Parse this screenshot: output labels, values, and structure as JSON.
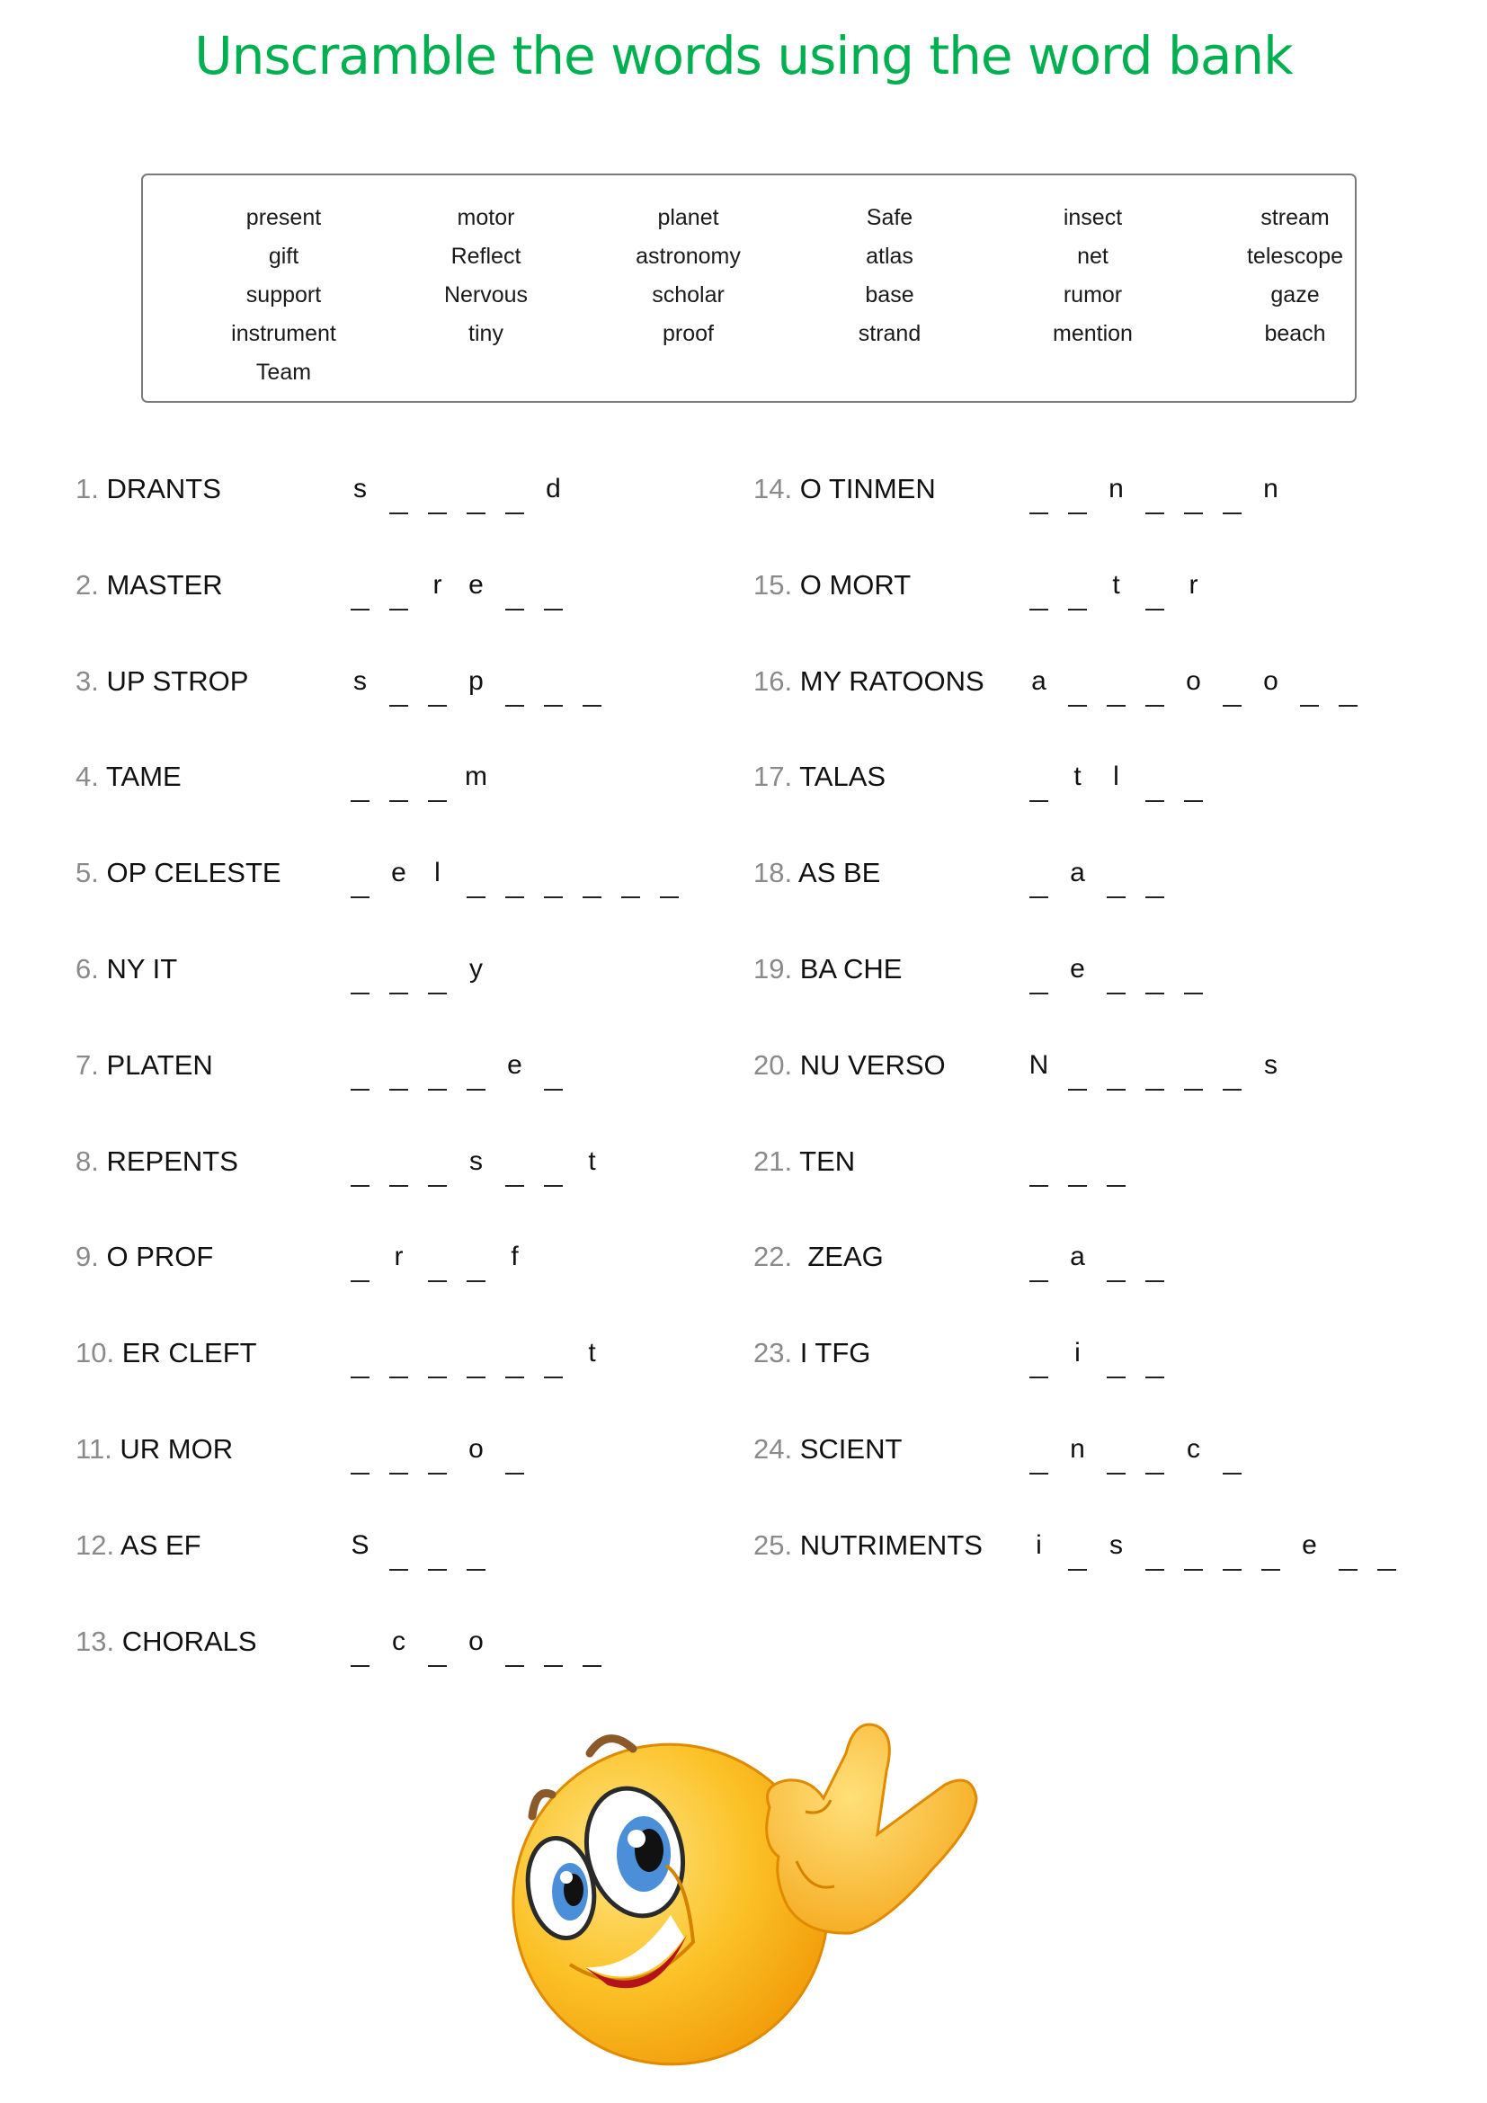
{
  "title": "Unscramble the words using  the word bank",
  "word_bank": {
    "columns": [
      [
        "present",
        "gift",
        "support",
        "instrument",
        "Team"
      ],
      [
        "motor",
        "Reflect",
        "Nervous",
        "tiny"
      ],
      [
        "planet",
        "astronomy",
        "scholar",
        "proof"
      ],
      [
        "Safe",
        "atlas",
        "base",
        "strand"
      ],
      [
        "insect",
        "net",
        "rumor",
        "mention"
      ],
      [
        "stream",
        "telescope",
        "gaze",
        "beach"
      ]
    ]
  },
  "exercises": {
    "left": [
      {
        "num": "1.",
        "word": " DRANTS",
        "pattern": [
          "s",
          "_",
          "_",
          "_",
          "_",
          "d"
        ]
      },
      {
        "num": "2.",
        "word": " MASTER",
        "pattern": [
          "_",
          "_",
          "r",
          "e",
          "_",
          "_"
        ]
      },
      {
        "num": "3.",
        "word": " UP STROP",
        "pattern": [
          "s",
          "_",
          "_",
          "p",
          "_",
          "_",
          "_"
        ]
      },
      {
        "num": "4.",
        "word": " TAME",
        "pattern": [
          "_",
          "_",
          "_",
          "m"
        ]
      },
      {
        "num": "5.",
        "word": " OP CELESTE",
        "pattern": [
          "_",
          "e",
          "l",
          "_",
          "_",
          "_",
          "_",
          "_",
          "_"
        ]
      },
      {
        "num": "6.",
        "word": " NY IT",
        "pattern": [
          "_",
          "_",
          "_",
          "y"
        ]
      },
      {
        "num": "7.",
        "word": " PLATEN",
        "pattern": [
          "_",
          "_",
          "_",
          "_",
          "e",
          "_"
        ]
      },
      {
        "num": "8.",
        "word": " REPENTS",
        "pattern": [
          "_",
          "_",
          "_",
          "s",
          "_",
          "_",
          "t"
        ]
      },
      {
        "num": "9.",
        "word": " O PROF",
        "pattern": [
          "_",
          "r",
          "_",
          "_",
          "f"
        ]
      },
      {
        "num": "10.",
        "word": " ER CLEFT",
        "pattern": [
          "_",
          "_",
          "_",
          "_",
          "_",
          "_",
          "t"
        ]
      },
      {
        "num": "11.",
        "word": " UR MOR",
        "pattern": [
          "_",
          "_",
          "_",
          "o",
          "_"
        ]
      },
      {
        "num": "12.",
        "word": " AS EF",
        "pattern": [
          "S",
          "_",
          "_",
          "_"
        ]
      },
      {
        "num": "13.",
        "word": " CHORALS",
        "pattern": [
          "_",
          "c",
          "_",
          "o",
          "_",
          "_",
          "_"
        ]
      }
    ],
    "right": [
      {
        "num": "14.",
        "word": " O TINMEN",
        "pattern": [
          "_",
          "_",
          "n",
          "_",
          "_",
          "_",
          "n"
        ]
      },
      {
        "num": "15.",
        "word": " O MORT",
        "pattern": [
          "_",
          "_",
          "t",
          "_",
          "r"
        ]
      },
      {
        "num": "16.",
        "word": " MY RATOONS",
        "pattern": [
          "a",
          "_",
          "_",
          "_",
          "o",
          "_",
          "o",
          "_",
          "_"
        ]
      },
      {
        "num": "17.",
        "word": " TALAS",
        "pattern": [
          "_",
          "t",
          "l",
          "_",
          "_"
        ]
      },
      {
        "num": "18.",
        "word": " AS BE",
        "pattern": [
          "_",
          "a",
          "_",
          "_"
        ]
      },
      {
        "num": "19.",
        "word": " BA CHE",
        "pattern": [
          "_",
          "e",
          "_",
          "_",
          "_"
        ]
      },
      {
        "num": "20.",
        "word": " NU VERSO",
        "pattern": [
          "N",
          "_",
          "_",
          "_",
          "_",
          "_",
          "s"
        ]
      },
      {
        "num": "21.",
        "word": " TEN",
        "pattern": [
          "_",
          "_",
          "_"
        ]
      },
      {
        "num": "22.",
        "word": "  ZEAG",
        "pattern": [
          "_",
          "a",
          "_",
          "_"
        ]
      },
      {
        "num": "23.",
        "word": " I TFG",
        "pattern": [
          "_",
          "i",
          "_",
          "_"
        ]
      },
      {
        "num": "24.",
        "word": " SCIENT",
        "pattern": [
          "_",
          "n",
          "_",
          "_",
          "c",
          "_"
        ]
      },
      {
        "num": "25.",
        "word": " NUTRIMENTS",
        "pattern": [
          "i",
          "_",
          "s",
          "_",
          "_",
          "_",
          "_",
          "e",
          "_",
          "_"
        ]
      }
    ]
  },
  "illustration": {
    "icon": "winking-smiley-emoji-icon",
    "colors": {
      "face": "#f9b918",
      "face_light": "#ffe27a",
      "outline": "#e08a00",
      "iris": "#4a8fd8",
      "mouth": "#b5131b",
      "brow": "#8b5a2b"
    }
  },
  "colors": {
    "title": "#00b050",
    "number": "#8a8a8a",
    "text": "#111111",
    "border": "#7a7a7a"
  }
}
